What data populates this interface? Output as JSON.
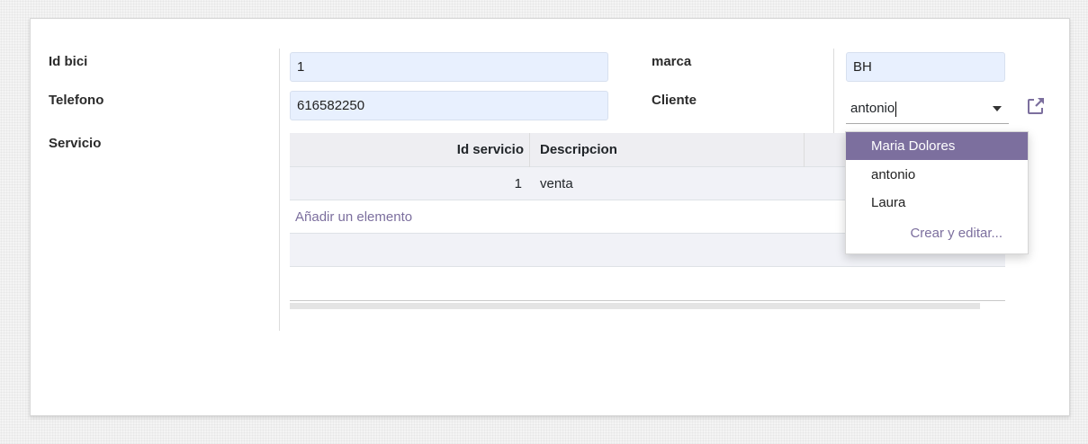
{
  "form": {
    "id_bici_label": "Id bici",
    "telefono_label": "Telefono",
    "servicio_label": "Servicio",
    "marca_label": "marca",
    "cliente_label": "Cliente",
    "id_bici_value": "1",
    "telefono_value": "616582250",
    "marca_value": "BH",
    "cliente_value": "antonio"
  },
  "servicio_table": {
    "columns": [
      "Id servicio",
      "Descripcion"
    ],
    "rows": [
      {
        "id": "1",
        "descripcion": "venta"
      }
    ],
    "add_item_label": "Añadir un elemento"
  },
  "cliente_dropdown": {
    "options": [
      "Maria Dolores",
      "antonio",
      "Laura"
    ],
    "highlighted": "Maria Dolores",
    "create_label": "Crear y editar..."
  },
  "icons": {
    "external_link": "external-link-icon",
    "dropdown_caret": "caret-down-icon"
  },
  "colors": {
    "accent": "#7c6f9e",
    "input_bg": "#e8f0fe"
  }
}
